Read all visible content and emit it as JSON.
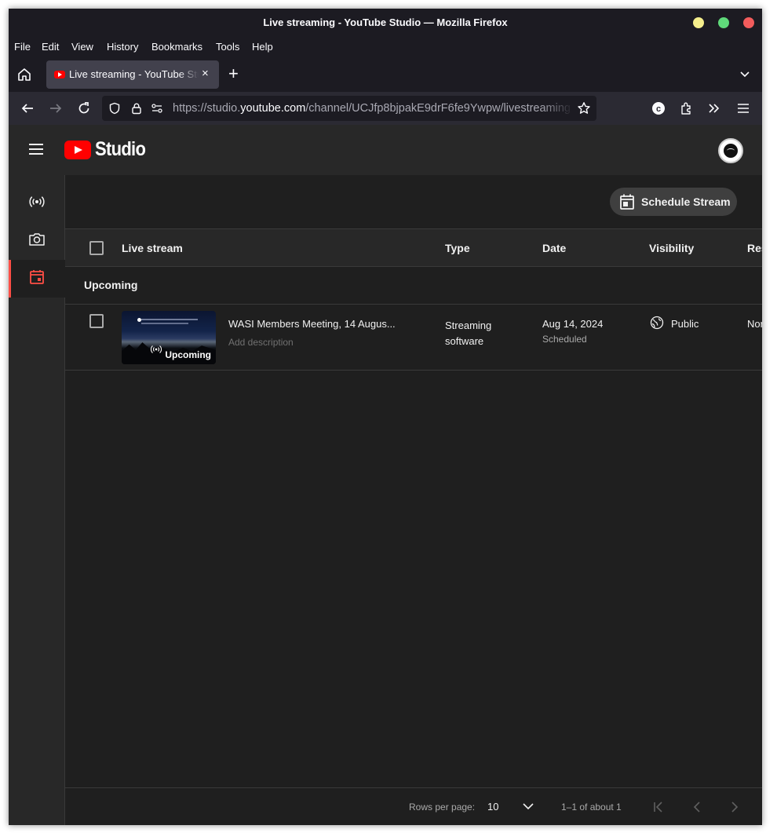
{
  "window": {
    "title": "Live streaming - YouTube Studio — Mozilla Firefox"
  },
  "menu": [
    "File",
    "Edit",
    "View",
    "History",
    "Bookmarks",
    "Tools",
    "Help"
  ],
  "tab": {
    "title": "Live streaming - YouTube Studio",
    "close": "×",
    "new_tab": "+"
  },
  "url": {
    "prefix": "https://studio.",
    "domain": "youtube.com",
    "path": "/channel/UCJfp8bjpakE9drF6fe9Ywpw/livestreaming"
  },
  "header": {
    "app_name": "Studio"
  },
  "toolbar": {
    "schedule_stream_label": "Schedule Stream"
  },
  "table": {
    "headers": [
      "Live stream",
      "Type",
      "Date",
      "Visibility",
      "Res"
    ],
    "section_label": "Upcoming",
    "rows": [
      {
        "title": "WASI Members Meeting, 14 Augus...",
        "description": "Add description",
        "badge": "Upcoming",
        "type": "Streaming software",
        "date": "Aug 14, 2024",
        "status": "Scheduled",
        "visibility": "Public",
        "restrictions": "Non"
      }
    ]
  },
  "pagination": {
    "rows_per_page_label": "Rows per page:",
    "rows_per_page_value": "10",
    "range": "1–1 of about 1"
  },
  "colors": {
    "accent": "#ff4e45",
    "youtube_red": "#ff0000",
    "background": "#1f1f1f"
  }
}
